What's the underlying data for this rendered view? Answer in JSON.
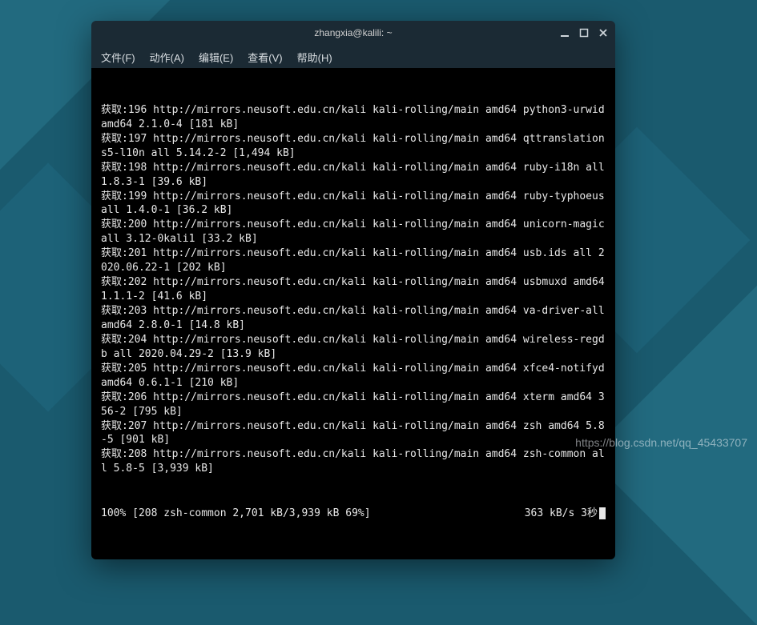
{
  "window": {
    "title": "zhangxia@kalili: ~",
    "menu": {
      "file": "文件(F)",
      "action": "动作(A)",
      "edit": "编辑(E)",
      "view": "查看(V)",
      "help": "帮助(H)"
    }
  },
  "terminal": {
    "lines": [
      "获取:196 http://mirrors.neusoft.edu.cn/kali kali-rolling/main amd64 python3-urwid amd64 2.1.0-4 [181 kB]",
      "获取:197 http://mirrors.neusoft.edu.cn/kali kali-rolling/main amd64 qttranslations5-l10n all 5.14.2-2 [1,494 kB]",
      "获取:198 http://mirrors.neusoft.edu.cn/kali kali-rolling/main amd64 ruby-i18n all 1.8.3-1 [39.6 kB]",
      "获取:199 http://mirrors.neusoft.edu.cn/kali kali-rolling/main amd64 ruby-typhoeus all 1.4.0-1 [36.2 kB]",
      "获取:200 http://mirrors.neusoft.edu.cn/kali kali-rolling/main amd64 unicorn-magic all 3.12-0kali1 [33.2 kB]",
      "获取:201 http://mirrors.neusoft.edu.cn/kali kali-rolling/main amd64 usb.ids all 2020.06.22-1 [202 kB]",
      "获取:202 http://mirrors.neusoft.edu.cn/kali kali-rolling/main amd64 usbmuxd amd64 1.1.1-2 [41.6 kB]",
      "获取:203 http://mirrors.neusoft.edu.cn/kali kali-rolling/main amd64 va-driver-all amd64 2.8.0-1 [14.8 kB]",
      "获取:204 http://mirrors.neusoft.edu.cn/kali kali-rolling/main amd64 wireless-regdb all 2020.04.29-2 [13.9 kB]",
      "获取:205 http://mirrors.neusoft.edu.cn/kali kali-rolling/main amd64 xfce4-notifyd amd64 0.6.1-1 [210 kB]",
      "获取:206 http://mirrors.neusoft.edu.cn/kali kali-rolling/main amd64 xterm amd64 356-2 [795 kB]",
      "获取:207 http://mirrors.neusoft.edu.cn/kali kali-rolling/main amd64 zsh amd64 5.8-5 [901 kB]",
      "获取:208 http://mirrors.neusoft.edu.cn/kali kali-rolling/main amd64 zsh-common all 5.8-5 [3,939 kB]"
    ],
    "progress_left": "100% [208 zsh-common 2,701 kB/3,939 kB 69%]",
    "progress_right": "363 kB/s 3秒"
  },
  "watermark": "https://blog.csdn.net/qq_45433707"
}
